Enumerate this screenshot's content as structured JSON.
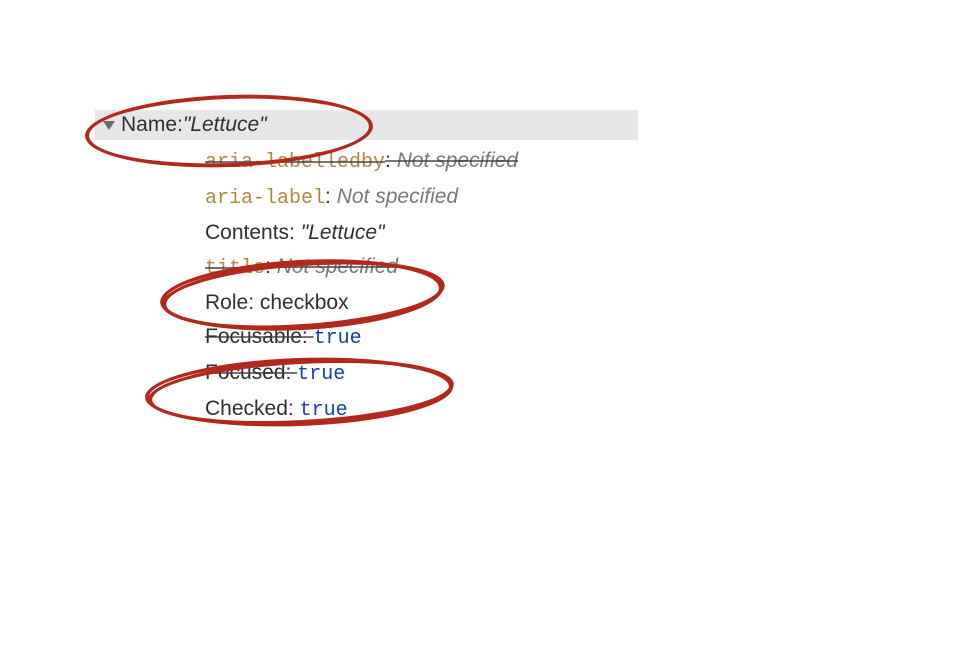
{
  "header": {
    "name_label": "Name: ",
    "name_value": "\"Lettuce\""
  },
  "details": {
    "aria_labelledby_key": "aria-labelledby",
    "aria_labelledby_val": "Not specified",
    "aria_label_key": "aria-label",
    "aria_label_val": "Not specified",
    "contents_key": "Contents: ",
    "contents_val": "\"Lettuce\"",
    "title_key": "title",
    "title_val": "Not specified"
  },
  "states": {
    "role_key": "Role: ",
    "role_val": "checkbox",
    "focusable_key": "Focusable: ",
    "focusable_val": "true",
    "focused_key": "Focused: ",
    "focused_val": "true",
    "checked_key": "Checked: ",
    "checked_val": "true"
  }
}
